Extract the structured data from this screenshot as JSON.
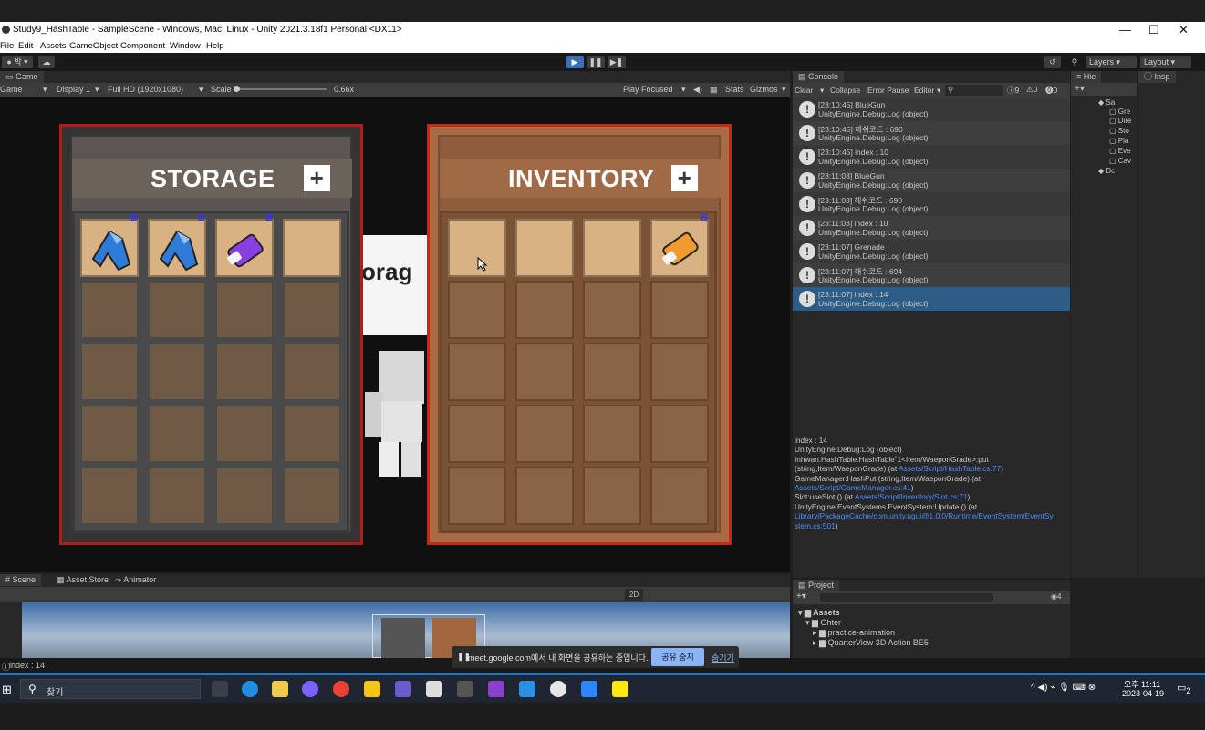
{
  "window": {
    "title": "Study9_HashTable - SampleScene - Windows, Mac, Linux - Unity 2021.3.18f1 Personal <DX11>",
    "controls": [
      "—",
      "☐",
      "✕"
    ]
  },
  "menu": [
    "File",
    "Edit",
    "Assets",
    "GameObject",
    "Component",
    "Window",
    "Help"
  ],
  "toolbar": {
    "account": "박",
    "layers_label": "Layers",
    "layout_label": "Layout"
  },
  "game_panel": {
    "tab_label": "Game",
    "mode": "Game",
    "display": "Display 1",
    "resolution": "Full HD (1920x1080)",
    "scale_label": "Scale",
    "scale_value": "0.66x",
    "play_focused": "Play Focused",
    "stats": "Stats",
    "gizmos": "Gizmos"
  },
  "storage": {
    "title": "STORAGE",
    "plus": "+",
    "slots": [
      {
        "filled": true,
        "badge": "B",
        "item": "blue-gun"
      },
      {
        "filled": true,
        "badge": "B",
        "item": "blue-gun"
      },
      {
        "filled": true,
        "badge": "B",
        "item": "purple-grenade"
      },
      {
        "filled": true,
        "badge": "",
        "item": ""
      }
    ]
  },
  "inventory": {
    "title": "INVENTORY",
    "plus": "+",
    "slots": [
      {
        "filled": true,
        "badge": "",
        "item": ""
      },
      {
        "filled": true,
        "badge": "",
        "item": ""
      },
      {
        "filled": true,
        "badge": "",
        "item": ""
      },
      {
        "filled": true,
        "badge": "B",
        "item": "orange-grenade"
      }
    ]
  },
  "scene_background_text": "orag",
  "console": {
    "tab_label": "Console",
    "clear": "Clear",
    "collapse": "Collapse",
    "error_pause": "Error Pause",
    "editor": "Editor",
    "count_log": "9",
    "count_warn": "0",
    "count_error": "0",
    "logs": [
      {
        "line1": "[23:10:45] BlueGun",
        "line2": "UnityEngine.Debug:Log (object)"
      },
      {
        "line1": "[23:10:45] 해쉬코드 : 690",
        "line2": "UnityEngine.Debug:Log (object)"
      },
      {
        "line1": "[23:10:45] index : 10",
        "line2": "UnityEngine.Debug:Log (object)"
      },
      {
        "line1": "[23:11:03] BlueGun",
        "line2": "UnityEngine.Debug:Log (object)"
      },
      {
        "line1": "[23:11:03] 해쉬코드 : 690",
        "line2": "UnityEngine.Debug:Log (object)"
      },
      {
        "line1": "[23:11:03] index : 10",
        "line2": "UnityEngine.Debug:Log (object)"
      },
      {
        "line1": "[23:11:07] Grenade",
        "line2": "UnityEngine.Debug:Log (object)"
      },
      {
        "line1": "[23:11:07] 해쉬코드 : 694",
        "line2": "UnityEngine.Debug:Log (object)"
      },
      {
        "line1": "[23:11:07] index : 14",
        "line2": "UnityEngine.Debug:Log (object)"
      }
    ],
    "stack": {
      "l1": "index : 14",
      "l2": "UnityEngine.Debug:Log (object)",
      "l3": "Inhwan.HashTable.HashTable`1<Item/WaeponGrade>:put",
      "l4a": "(string,Item/WaeponGrade) (at ",
      "l4b": "Assets/Script/HashTable.cs:77",
      "l4c": ")",
      "l5": "GameManager:HashPut (string,Item/WaeponGrade) (at",
      "l6": "Assets/Script/GameManager.cs:41",
      "l6c": ")",
      "l7a": "Slot:useSlot () (at ",
      "l7b": "Assets/Script/Inventory/Slot.cs:71",
      "l7c": ")",
      "l8": "UnityEngine.EventSystems.EventSystem:Update () (at",
      "l9": "Library/PackageCache/com.unity.ugui@1.0.0/Runtime/EventSystem/EventSy",
      "l10": "stem.cs:501",
      "l10c": ")"
    }
  },
  "hierarchy": {
    "tab_label": "Hie",
    "items": [
      "Sa",
      "Gre",
      "Dire",
      "Sto",
      "Pla",
      "Eve",
      "Cav",
      "Dc"
    ]
  },
  "inspector": {
    "tab_label": "Insp"
  },
  "project": {
    "tab_label": "Project",
    "count": "4",
    "tree": [
      "Assets",
      "Ohter",
      "practice-animation",
      "QuarterView 3D Action BE5"
    ]
  },
  "scene_panel": {
    "tabs": [
      "Scene",
      "Asset Store",
      "Animator"
    ],
    "mode_2d": "2D"
  },
  "status": {
    "text": "index : 14"
  },
  "meet_banner": {
    "text": "meet.google.com에서 내 화면을 공유하는 중입니다.",
    "stop": "공유 중지",
    "hide": "숨기기"
  },
  "taskbar": {
    "search": "찾기",
    "ampm": "오후 11:11",
    "date": "2023-04-19",
    "notif": "2"
  }
}
